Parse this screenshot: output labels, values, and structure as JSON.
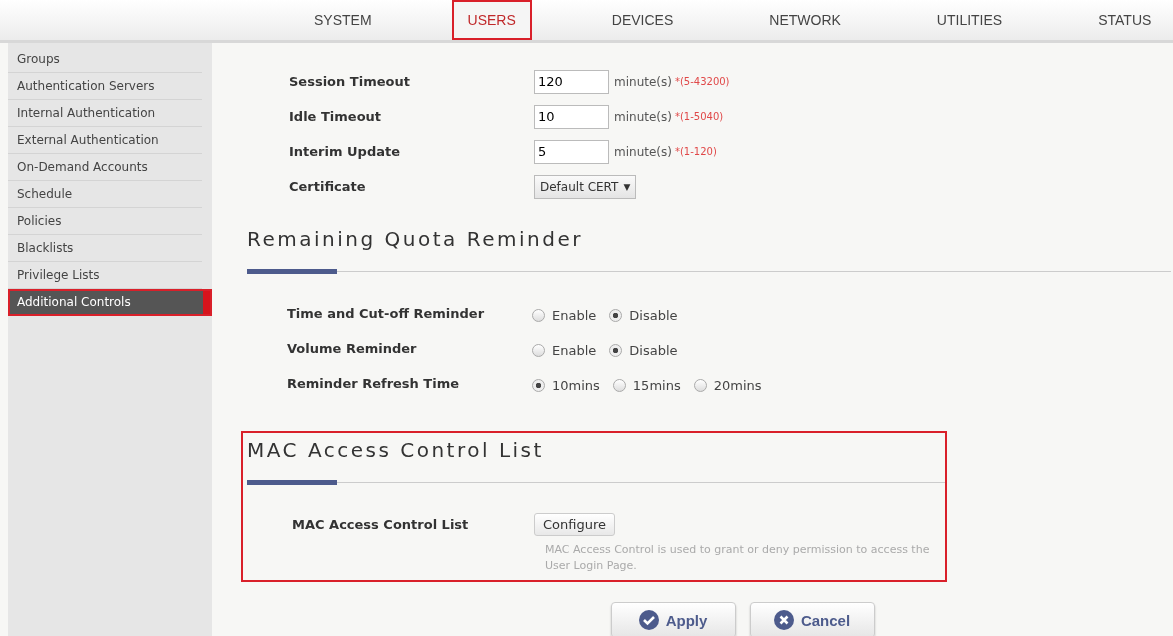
{
  "nav_tabs": [
    {
      "label": "SYSTEM",
      "selected": false,
      "highlighted": false
    },
    {
      "label": "USERS",
      "selected": true,
      "highlighted": true
    },
    {
      "label": "DEVICES",
      "selected": false,
      "highlighted": false
    },
    {
      "label": "NETWORK",
      "selected": false,
      "highlighted": false
    },
    {
      "label": "UTILITIES",
      "selected": false,
      "highlighted": false
    },
    {
      "label": "STATUS",
      "selected": false,
      "highlighted": false
    }
  ],
  "sidebar": {
    "items": [
      {
        "label": "Groups",
        "selected": false,
        "highlighted": false
      },
      {
        "label": "Authentication Servers",
        "selected": false,
        "highlighted": false
      },
      {
        "label": "Internal Authentication",
        "selected": false,
        "highlighted": false
      },
      {
        "label": "External Authentication",
        "selected": false,
        "highlighted": false
      },
      {
        "label": "On-Demand Accounts",
        "selected": false,
        "highlighted": false
      },
      {
        "label": "Schedule",
        "selected": false,
        "highlighted": false
      },
      {
        "label": "Policies",
        "selected": false,
        "highlighted": false
      },
      {
        "label": "Blacklists",
        "selected": false,
        "highlighted": false
      },
      {
        "label": "Privilege Lists",
        "selected": false,
        "highlighted": false
      },
      {
        "label": "Additional Controls",
        "selected": true,
        "highlighted": true
      }
    ]
  },
  "timeouts": [
    {
      "kind": "input",
      "label": "Session Timeout",
      "value": "120",
      "unit": "minute(s)",
      "range": "*(5-43200)"
    },
    {
      "kind": "input",
      "label": "Idle Timeout",
      "value": "10",
      "unit": "minute(s)",
      "range": "*(1-5040)"
    },
    {
      "kind": "input",
      "label": "Interim Update",
      "value": "5",
      "unit": "minute(s)",
      "range": "*(1-120)"
    },
    {
      "kind": "select",
      "label": "Certificate",
      "value": "Default CERT",
      "caret": "▼"
    }
  ],
  "quota_section": {
    "title": "Remaining Quota Reminder",
    "highlighted": false,
    "rows": [
      {
        "label": "Time and Cut-off Reminder",
        "options": [
          {
            "label": "Enable",
            "selected": false
          },
          {
            "label": "Disable",
            "selected": true
          }
        ]
      },
      {
        "label": "Volume Reminder",
        "options": [
          {
            "label": "Enable",
            "selected": false
          },
          {
            "label": "Disable",
            "selected": true
          }
        ]
      },
      {
        "label": "Reminder Refresh Time",
        "options": [
          {
            "label": "10mins",
            "selected": true
          },
          {
            "label": "15mins",
            "selected": false
          },
          {
            "label": "20mins",
            "selected": false
          }
        ]
      }
    ]
  },
  "mac_section": {
    "title": "MAC Access Control List",
    "highlighted": true,
    "label": "MAC Access Control List",
    "button": "Configure",
    "description": "MAC Access Control is used to grant or deny permission to access the User Login Page."
  },
  "buttons": [
    {
      "kind": "apply",
      "label": "Apply"
    },
    {
      "kind": "cancel",
      "label": "Cancel"
    }
  ]
}
